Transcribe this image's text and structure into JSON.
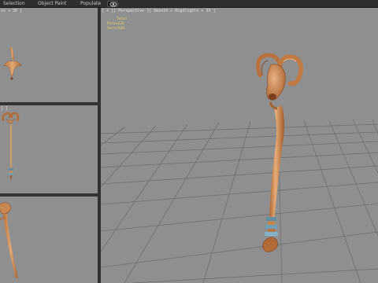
{
  "menubar": {
    "items": [
      {
        "label": "Selection"
      },
      {
        "label": "Object Paint"
      },
      {
        "label": "Populate"
      }
    ],
    "eye_icon": "eye-icon"
  },
  "viewports": {
    "top": {
      "label": "ss + 3X ]"
    },
    "front": {
      "label": "[ ]"
    },
    "left": {
      "label": ""
    },
    "perspective": {
      "label": "[ + ][ Perspective ][ Smooth + Highlights + 3X ]",
      "stats": {
        "total_label": "Total",
        "rows": [
          {
            "label": "Polys:",
            "value": "631"
          },
          {
            "label": "Verts:",
            "value": "636"
          }
        ]
      }
    }
  },
  "colors": {
    "viewport_bg": "#8f8f8f",
    "grid": "#6c6c6c",
    "staff_wood": "#d5955e",
    "staff_dark": "#8c4f2a",
    "band": "#6fa0b8",
    "stats_text": "#e8d860"
  }
}
